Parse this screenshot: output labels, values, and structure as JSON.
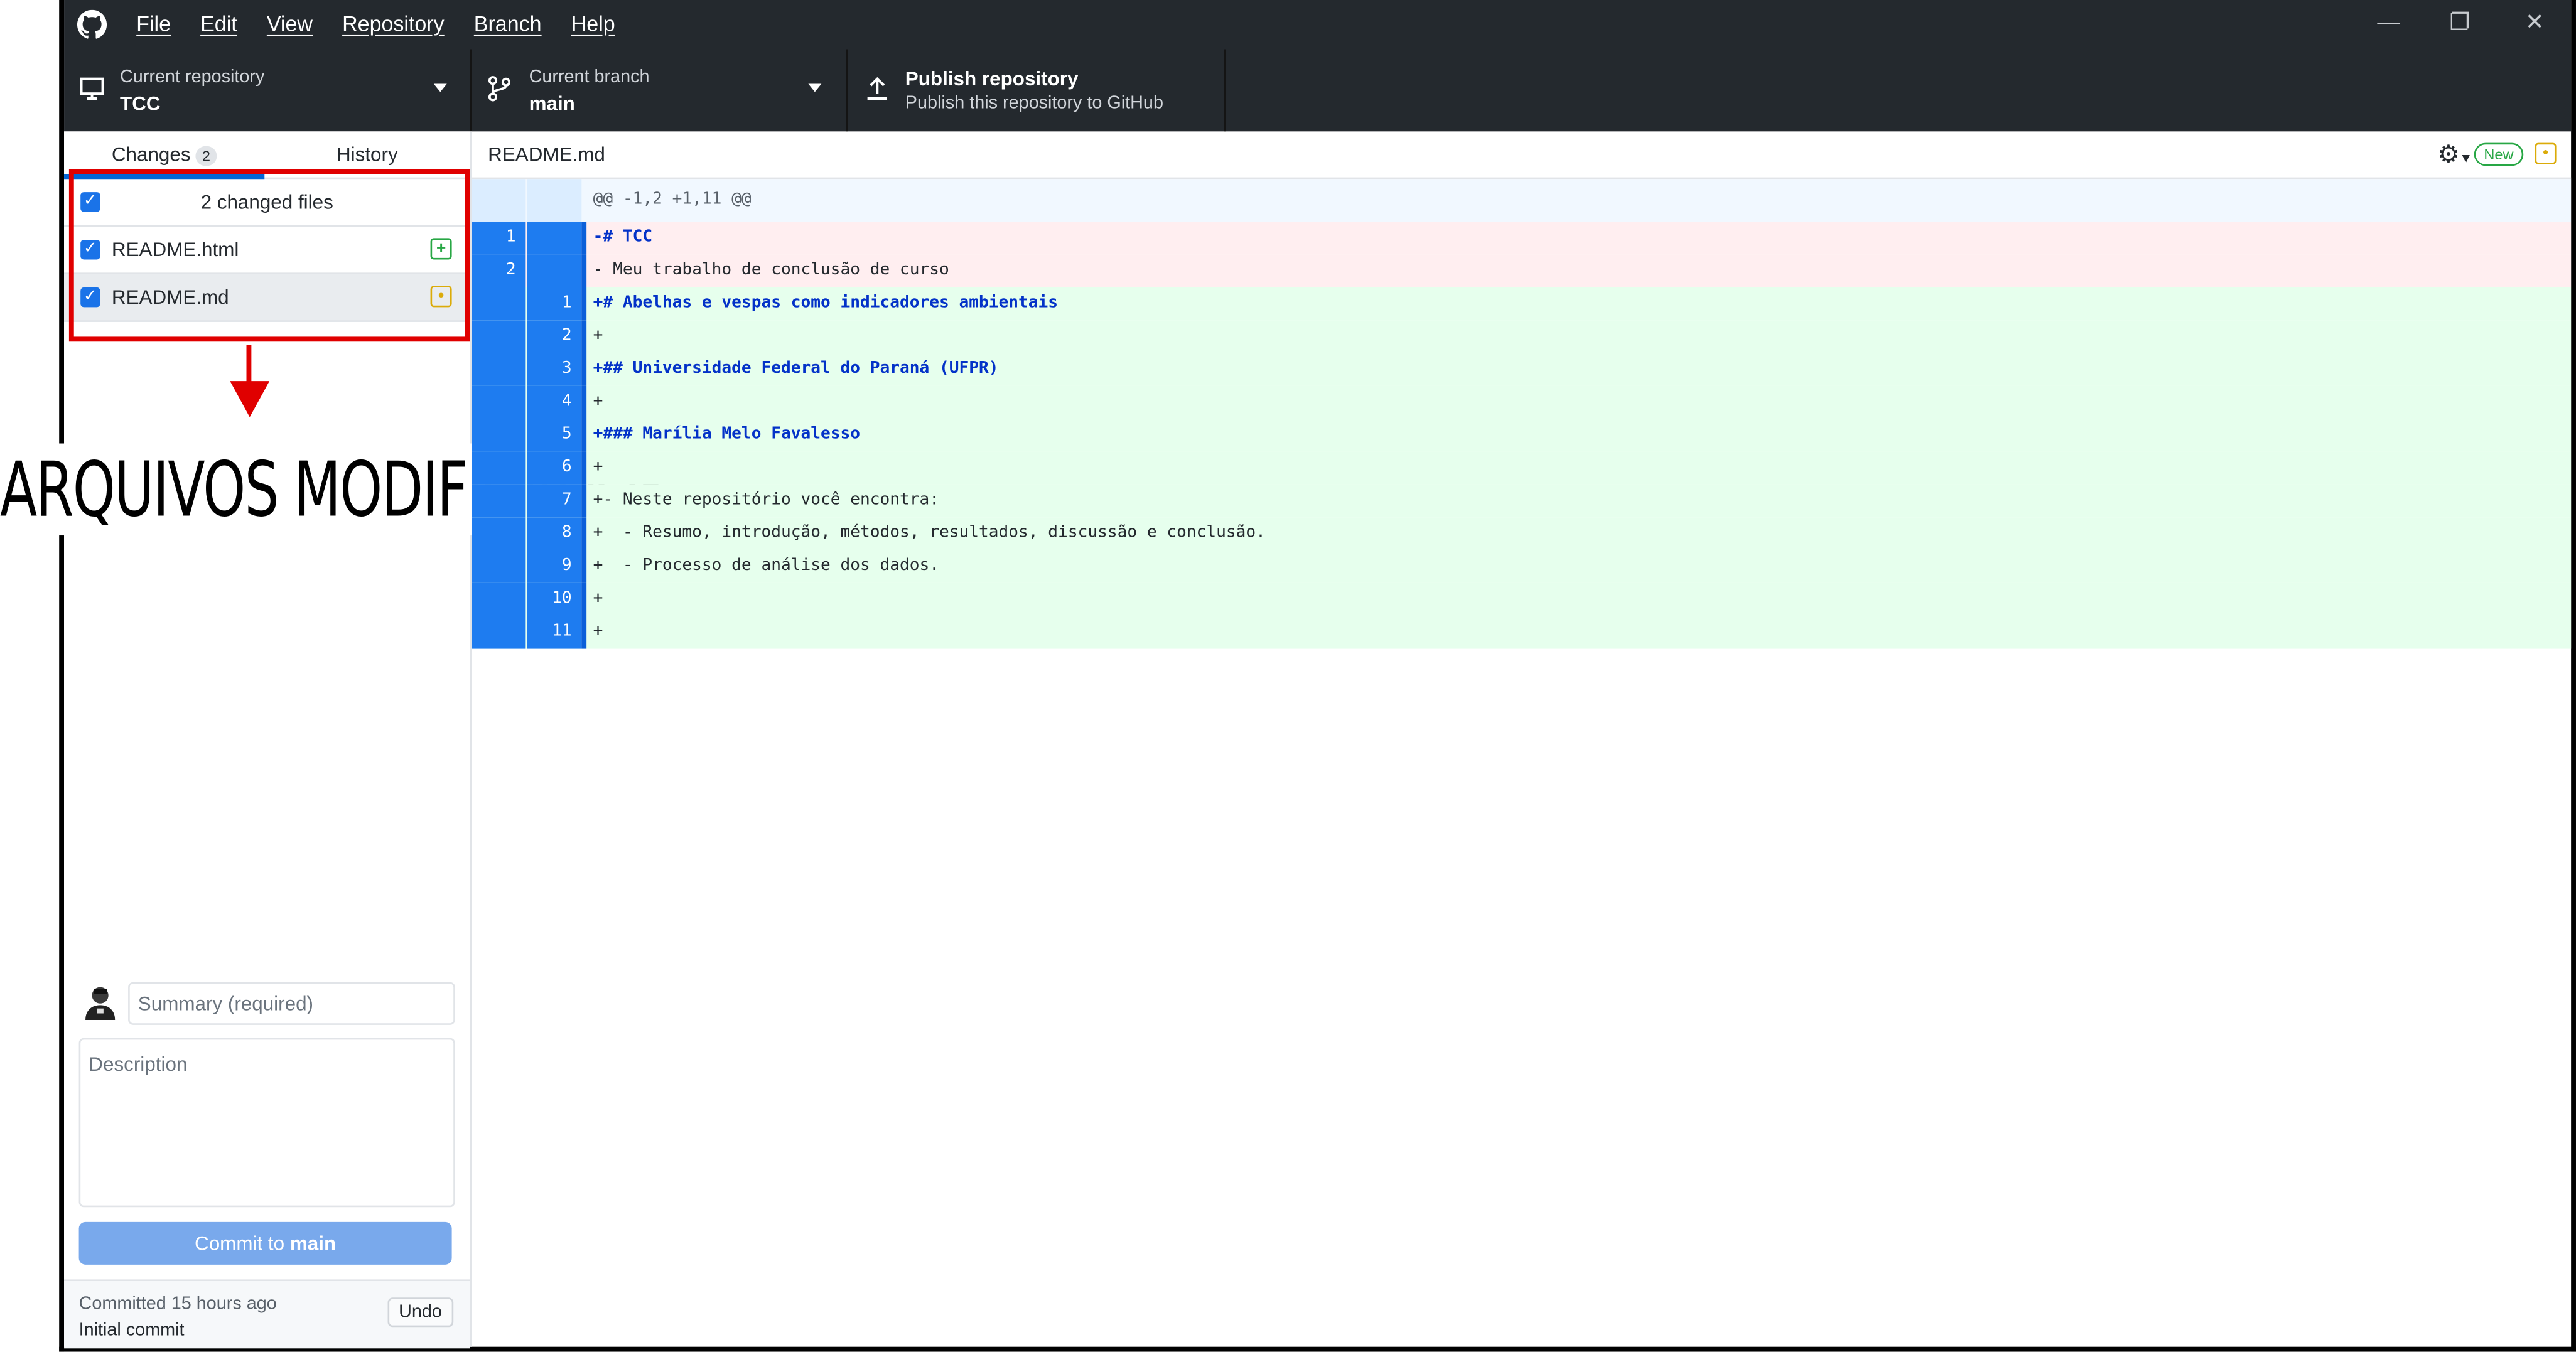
{
  "menu": [
    "File",
    "Edit",
    "View",
    "Repository",
    "Branch",
    "Help"
  ],
  "window_controls": {
    "minimize": "—",
    "restore": "❐",
    "close": "✕"
  },
  "toolbar": {
    "repo_caption": "Current repository",
    "repo_name": "TCC",
    "branch_caption": "Current branch",
    "branch_name": "main",
    "publish_title": "Publish repository",
    "publish_subtitle": "Publish this repository to GitHub"
  },
  "tabs": {
    "changes": "Changes",
    "changes_count": "2",
    "history": "History"
  },
  "changes": {
    "summary": "2 changed files",
    "files": [
      {
        "name": "README.html",
        "status": "added",
        "icon": "+"
      },
      {
        "name": "README.md",
        "status": "modified",
        "icon": "•"
      }
    ]
  },
  "annotation": {
    "text": "ARQUIVOS MODIFICADOS"
  },
  "commit": {
    "summary_placeholder": "Summary (required)",
    "description_placeholder": "Description",
    "button_prefix": "Commit to ",
    "button_branch": "main",
    "last_commit_time": "Committed 15 hours ago",
    "last_commit_message": "Initial commit",
    "undo_label": "Undo"
  },
  "diff": {
    "file_name": "README.md",
    "new_badge": "New",
    "hunk_header": "@@ -1,2 +1,11 @@",
    "lines": [
      {
        "type": "del",
        "old": "1",
        "new": "",
        "text": "-# TCC",
        "heading": true
      },
      {
        "type": "del",
        "old": "2",
        "new": "",
        "text": "- Meu trabalho de conclusão de curso",
        "heading": false
      },
      {
        "type": "add",
        "old": "",
        "new": "1",
        "text": "+# Abelhas e vespas como indicadores ambientais",
        "heading": true
      },
      {
        "type": "add",
        "old": "",
        "new": "2",
        "text": "+",
        "heading": false
      },
      {
        "type": "add",
        "old": "",
        "new": "3",
        "text": "+## Universidade Federal do Paraná (UFPR)",
        "heading": true
      },
      {
        "type": "add",
        "old": "",
        "new": "4",
        "text": "+",
        "heading": false
      },
      {
        "type": "add",
        "old": "",
        "new": "5",
        "text": "+### Marília Melo Favalesso",
        "heading": true
      },
      {
        "type": "add",
        "old": "",
        "new": "6",
        "text": "+",
        "heading": false
      },
      {
        "type": "add",
        "old": "",
        "new": "7",
        "text": "+- Neste repositório você encontra:",
        "heading": false
      },
      {
        "type": "add",
        "old": "",
        "new": "8",
        "text": "+  - Resumo, introdução, métodos, resultados, discussão e conclusão.",
        "heading": false
      },
      {
        "type": "add",
        "old": "",
        "new": "9",
        "text": "+  - Processo de análise dos dados.",
        "heading": false
      },
      {
        "type": "add",
        "old": "",
        "new": "10",
        "text": "+",
        "heading": false
      },
      {
        "type": "add",
        "old": "",
        "new": "11",
        "text": "+",
        "heading": false
      }
    ]
  },
  "colors": {
    "accent": "#0366d6",
    "added": "#28a745",
    "modified": "#dbab09",
    "annotation_red": "#e00000"
  }
}
